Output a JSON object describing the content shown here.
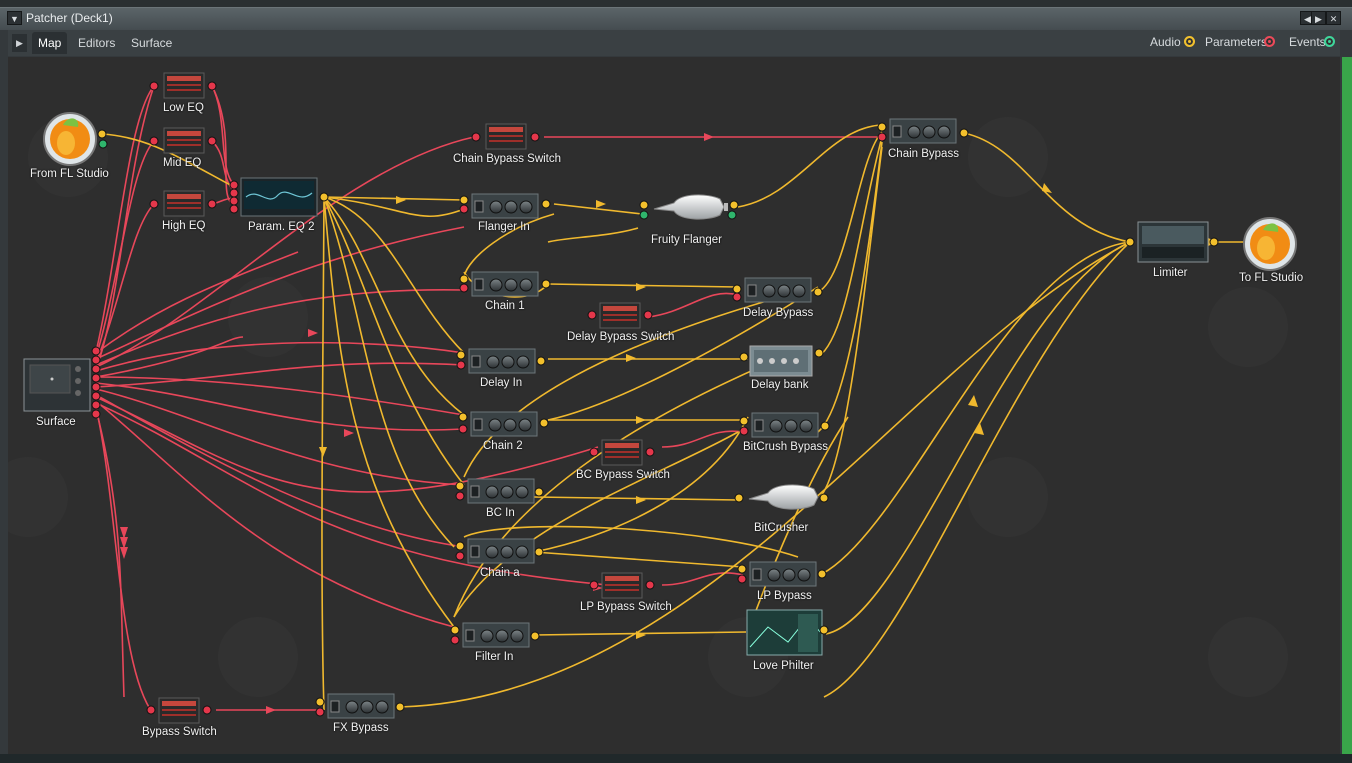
{
  "window": {
    "title": "Patcher (Deck1)"
  },
  "tabs": [
    {
      "label": "Map",
      "active": true
    },
    {
      "label": "Editors",
      "active": false
    },
    {
      "label": "Surface",
      "active": false
    }
  ],
  "filters": [
    {
      "label": "Audio",
      "color": "#f2c12e"
    },
    {
      "label": "Parameters",
      "color": "#ec4a5a"
    },
    {
      "label": "Events",
      "color": "#3fd69b"
    }
  ],
  "colors": {
    "audio_wire": "#f0b92e",
    "param_wire": "#e8475a",
    "port_audio": "#f3c02c",
    "port_param": "#e5374b",
    "port_event": "#2fb56c"
  },
  "modules": {
    "from_fl": "From FL Studio",
    "low_eq": "Low EQ",
    "mid_eq": "Mid EQ",
    "high_eq": "High EQ",
    "param_eq": "Param. EQ 2",
    "surface": "Surface",
    "chain_bypass_switch": "Chain Bypass Switch",
    "flanger_in": "Flanger In",
    "fruity_flanger": "Fruity Flanger",
    "chain_bypass": "Chain Bypass",
    "chain1": "Chain 1",
    "delay_bypass_switch": "Delay Bypass Switch",
    "delay_bypass": "Delay Bypass",
    "delay_in": "Delay In",
    "delay_bank": "Delay bank",
    "chain2": "Chain 2",
    "bc_bypass_switch": "BC Bypass Switch",
    "bitcrush_bypass": "BitCrush Bypass",
    "bc_in": "BC In",
    "bitcrusher": "BitCrusher",
    "chain_a": "Chain a",
    "lp_bypass_switch": "LP Bypass Switch",
    "lp_bypass": "LP Bypass",
    "filter_in": "Filter In",
    "love_philter": "Love Philter",
    "bypass_switch": "Bypass Switch",
    "fx_bypass": "FX Bypass",
    "limiter": "Limiter",
    "to_fl": "To FL Studio"
  }
}
